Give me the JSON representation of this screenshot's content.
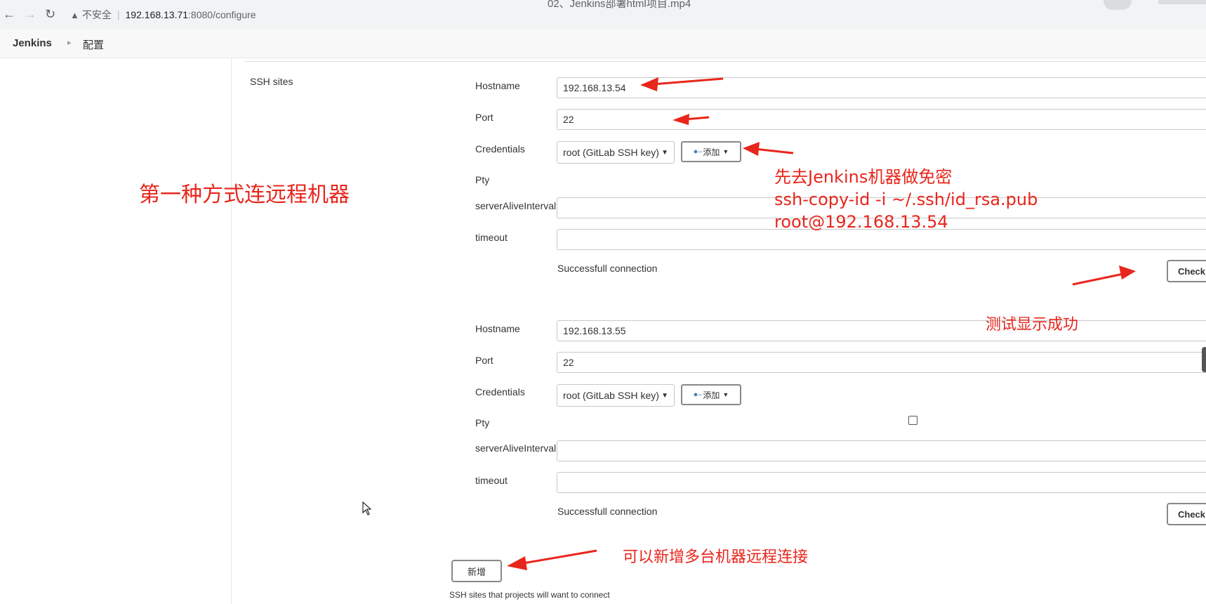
{
  "browser": {
    "tab_title": "02、Jenkins部署html项目.mp4",
    "back_icon": "back-arrow-icon",
    "forward_icon": "forward-arrow-icon",
    "reload_icon": "reload-icon",
    "insecure_label": "不安全",
    "url_host": "192.168.13.71",
    "url_path": ":8080/configure"
  },
  "breadcrumb": {
    "root": "Jenkins",
    "page": "配置"
  },
  "ssh_section": {
    "label": "SSH sites",
    "sites": [
      {
        "hostname_label": "Hostname",
        "hostname": "192.168.13.54",
        "port_label": "Port",
        "port": "22",
        "credentials_label": "Credentials",
        "credentials": "root (GitLab SSH key)",
        "add_label": "添加",
        "pty_label": "Pty",
        "alive_label": "serverAliveInterval",
        "alive_value": "",
        "timeout_label": "timeout",
        "timeout_value": "",
        "status": "Successfull connection",
        "check_label": "Check"
      },
      {
        "hostname_label": "Hostname",
        "hostname": "192.168.13.55",
        "port_label": "Port",
        "port": "22",
        "credentials_label": "Credentials",
        "credentials": "root (GitLab SSH key)",
        "add_label": "添加",
        "pty_label": "Pty",
        "pty_checked": false,
        "alive_label": "serverAliveInterval",
        "alive_value": "",
        "timeout_label": "timeout",
        "timeout_value": "",
        "status": "Successfull connection",
        "check_label": "Check"
      }
    ],
    "new_label": "新增",
    "help_text": "SSH sites that projects will want to connect"
  },
  "annotations": {
    "method": "第一种方式连远程机器",
    "note_line1": "先去Jenkins机器做免密",
    "note_line2": "ssh-copy-id -i ~/.ssh/id_rsa.pub",
    "note_line3": "root@192.168.13.54",
    "success": "测试显示成功",
    "add_more": "可以新增多台机器远程连接",
    "color": "#e8261c"
  }
}
